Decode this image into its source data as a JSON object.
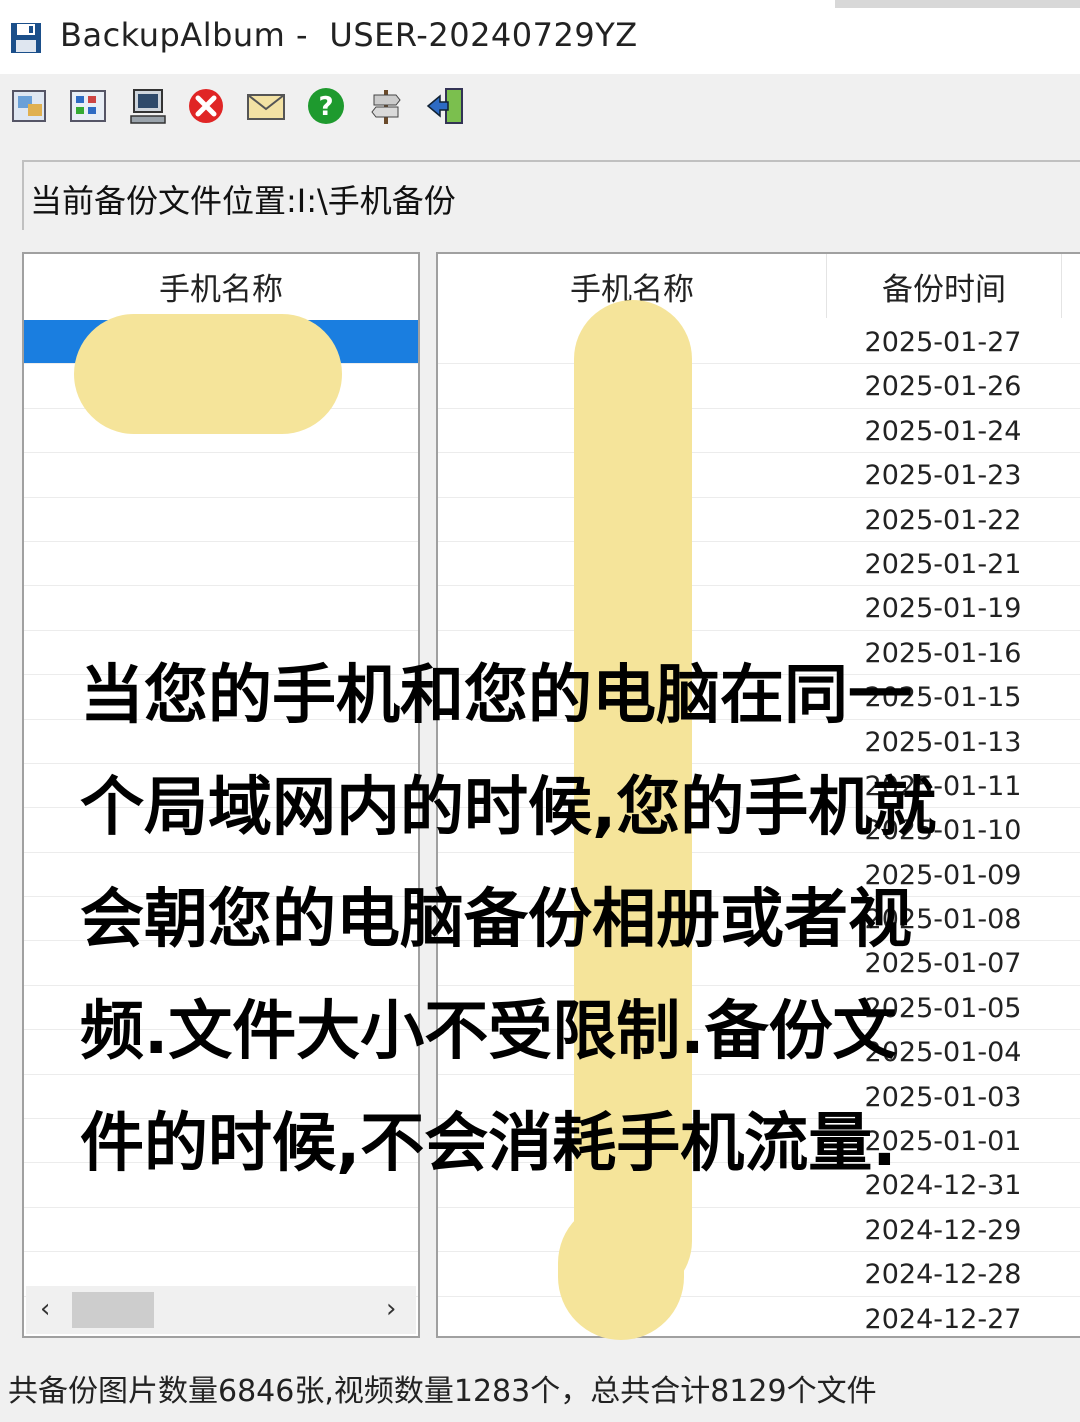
{
  "window": {
    "app_name": "BackupAlbum -  USER-20240729YZ"
  },
  "toolbar": {
    "icons": [
      "photo-icon",
      "grid-icon",
      "computer-icon",
      "close-circle-icon",
      "mail-icon",
      "help-icon",
      "signpost-icon",
      "exit-door-icon"
    ]
  },
  "path": {
    "label": "当前备份文件位置:I:\\手机备份"
  },
  "left_panel": {
    "header": "手机名称"
  },
  "right_panel": {
    "headers": [
      "手机名称",
      "备份时间"
    ],
    "dates": [
      "2025-01-27",
      "2025-01-26",
      "2025-01-24",
      "2025-01-23",
      "2025-01-22",
      "2025-01-21",
      "2025-01-19",
      "2025-01-16",
      "2025-01-15",
      "2025-01-13",
      "2025-01-11",
      "2025-01-10",
      "2025-01-09",
      "2025-01-08",
      "2025-01-07",
      "2025-01-05",
      "2025-01-04",
      "2025-01-03",
      "2025-01-01",
      "2024-12-31",
      "2024-12-29",
      "2024-12-28",
      "2024-12-27"
    ]
  },
  "status": {
    "text": "共备份图片数量6846张,视频数量1283个，总共合计8129个文件"
  },
  "overlay": {
    "lines": [
      "当您的手机和您的电脑在同一",
      "个局域网内的时候,您的手机就",
      "会朝您的电脑备份相册或者视",
      "频.文件大小不受限制.备份文",
      "件的时候,不会消耗手机流量."
    ]
  },
  "colors": {
    "selection": "#1a7ee0",
    "redaction": "#f5e49a"
  }
}
